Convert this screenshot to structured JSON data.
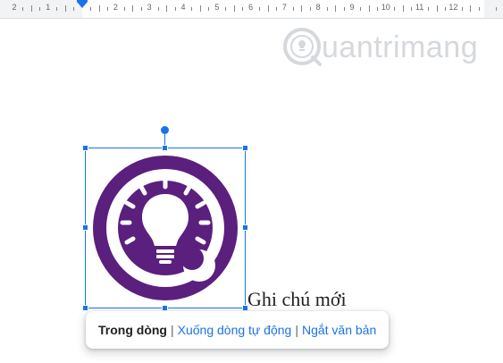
{
  "ruler": {
    "numbers": [
      "2",
      "1",
      "1",
      "2",
      "3",
      "4",
      "5",
      "6",
      "7",
      "8",
      "9",
      "10",
      "11",
      "12"
    ]
  },
  "watermark": {
    "text": "uantrimang",
    "icon": "lightbulb-circle-logo-icon"
  },
  "image": {
    "icon": "lightbulb-note-logo-icon",
    "ring_color": "#5b1f7e"
  },
  "document": {
    "note_text": "Ghi chú mới"
  },
  "wrap_toolbar": {
    "inline_label": "Trong dòng",
    "separator": "|",
    "wrap_text_label": "Xuống dòng tự động",
    "break_text_label": "Ngắt văn bản"
  },
  "colors": {
    "accent": "#1a73e8",
    "purple": "#5b1f7e"
  }
}
